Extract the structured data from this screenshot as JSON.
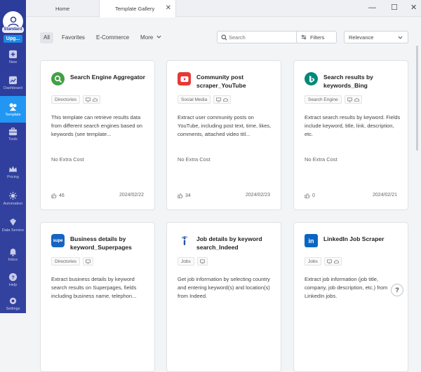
{
  "window": {
    "minimize": "—",
    "maximize": "☐",
    "close": "✕"
  },
  "tabs": [
    {
      "label": "Home"
    },
    {
      "label": "Template Gallery",
      "close": "✕"
    }
  ],
  "sidebar": {
    "plan_badge": "Standard",
    "upgrade_label": "Upg...",
    "items": [
      {
        "label": "New",
        "icon": "plus-square-icon"
      },
      {
        "label": "Dashboard",
        "icon": "dashboard-icon"
      },
      {
        "label": "Template",
        "icon": "template-icon",
        "active": true
      },
      {
        "label": "Tools",
        "icon": "toolbox-icon"
      },
      {
        "label": "Pricing",
        "icon": "crown-icon"
      },
      {
        "label": "Automation",
        "icon": "automation-icon"
      },
      {
        "label": "Data Service",
        "icon": "data-service-icon"
      },
      {
        "label": "Inbox",
        "icon": "bell-icon"
      },
      {
        "label": "Help",
        "icon": "help-icon"
      },
      {
        "label": "Settings",
        "icon": "settings-icon"
      }
    ]
  },
  "filters": {
    "tabs": [
      "All",
      "Favorites",
      "E-Commerce",
      "More"
    ],
    "search_placeholder": "Search",
    "filters_label": "Filters",
    "sort_label": "Relevance"
  },
  "cards": [
    {
      "title": "Search Engine Aggregator",
      "tag": "Directories",
      "description": "This template can retrieve results data from different search engines based on keywords (see template...",
      "cost": "No Extra Cost",
      "likes": "46",
      "date": "2024/02/22",
      "icon": "search-engine-icon",
      "icon_color": "#43a047"
    },
    {
      "title": "Community post scraper_YouTube",
      "tag": "Social Media",
      "description": "Extract user community posts on YouTube, including post text, time, likes, comments, attached video titl...",
      "cost": "No Extra Cost",
      "likes": "34",
      "date": "2024/02/23",
      "icon": "youtube-icon",
      "icon_color": "#e53935"
    },
    {
      "title": "Search results by keywords_Bing",
      "tag": "Search Engine",
      "description": "Extract search results by keyword. Fields include keyword, title, link, description, etc.",
      "cost": "No Extra Cost",
      "likes": "0",
      "date": "2024/02/21",
      "icon": "bing-icon",
      "icon_color": "#00897b"
    },
    {
      "title": "Business details by keyword_Superpages",
      "tag": "Directories",
      "description": "Extract business details by keyword search results on Superpages, fields including business name, telephon...",
      "icon": "superpages-icon",
      "icon_color": "#1565c0",
      "icon_text": "supe"
    },
    {
      "title": "Job details by keyword search_Indeed",
      "tag": "Jobs",
      "description": "Get job information by selecting country and entering keyword(s) and location(s) from Indeed.",
      "icon": "indeed-icon",
      "icon_color": "#2557a7"
    },
    {
      "title": "LinkedIn Job Scraper",
      "tag": "Jobs",
      "description": "Extract job information (job title, company, job description, etc.) from LinkedIn jobs.",
      "icon": "linkedin-icon",
      "icon_color": "#0a66c2",
      "icon_text": "in"
    }
  ],
  "help_button": "?"
}
